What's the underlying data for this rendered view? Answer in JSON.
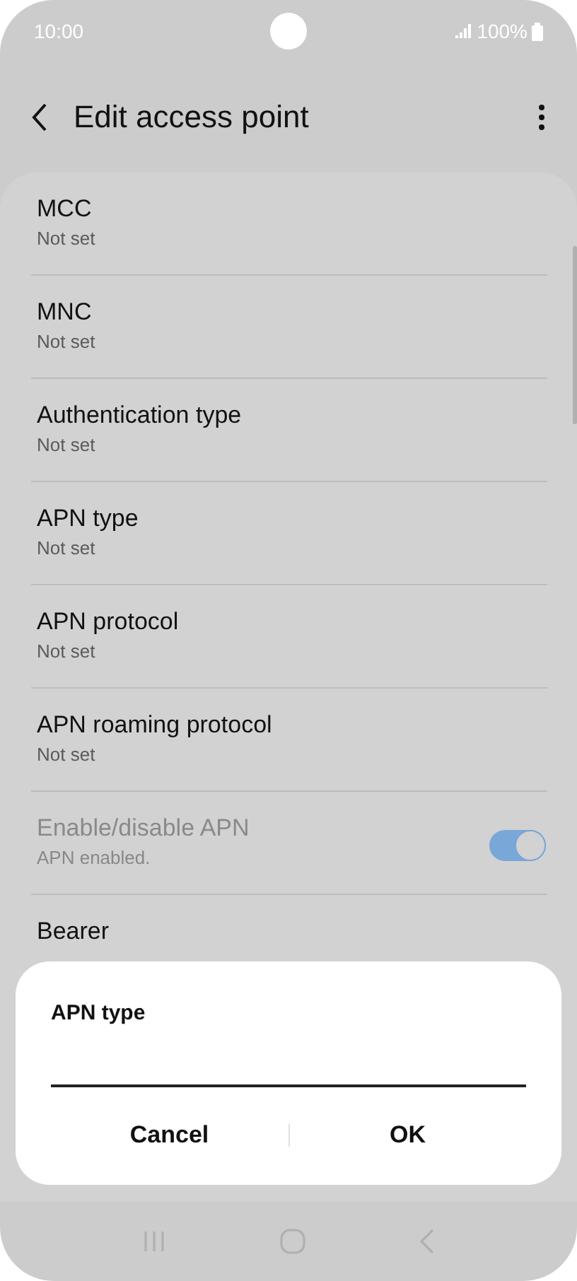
{
  "status_bar": {
    "time": "10:00",
    "battery": "100%"
  },
  "header": {
    "title": "Edit access point"
  },
  "settings": [
    {
      "kind": "text",
      "title": "MCC",
      "subtitle": "Not set",
      "disabled": false
    },
    {
      "kind": "text",
      "title": "MNC",
      "subtitle": "Not set",
      "disabled": false
    },
    {
      "kind": "text",
      "title": "Authentication type",
      "subtitle": "Not set",
      "disabled": false
    },
    {
      "kind": "text",
      "title": "APN type",
      "subtitle": "Not set",
      "disabled": false
    },
    {
      "kind": "text",
      "title": "APN protocol",
      "subtitle": "Not set",
      "disabled": false
    },
    {
      "kind": "text",
      "title": "APN roaming protocol",
      "subtitle": "Not set",
      "disabled": false
    },
    {
      "kind": "switch",
      "title": "Enable/disable APN",
      "subtitle": "APN enabled.",
      "disabled": true,
      "on": true
    },
    {
      "kind": "text",
      "title": "Bearer",
      "disabled": false
    }
  ],
  "dialog": {
    "title": "APN type",
    "buttons": [
      "Cancel",
      "OK"
    ]
  }
}
